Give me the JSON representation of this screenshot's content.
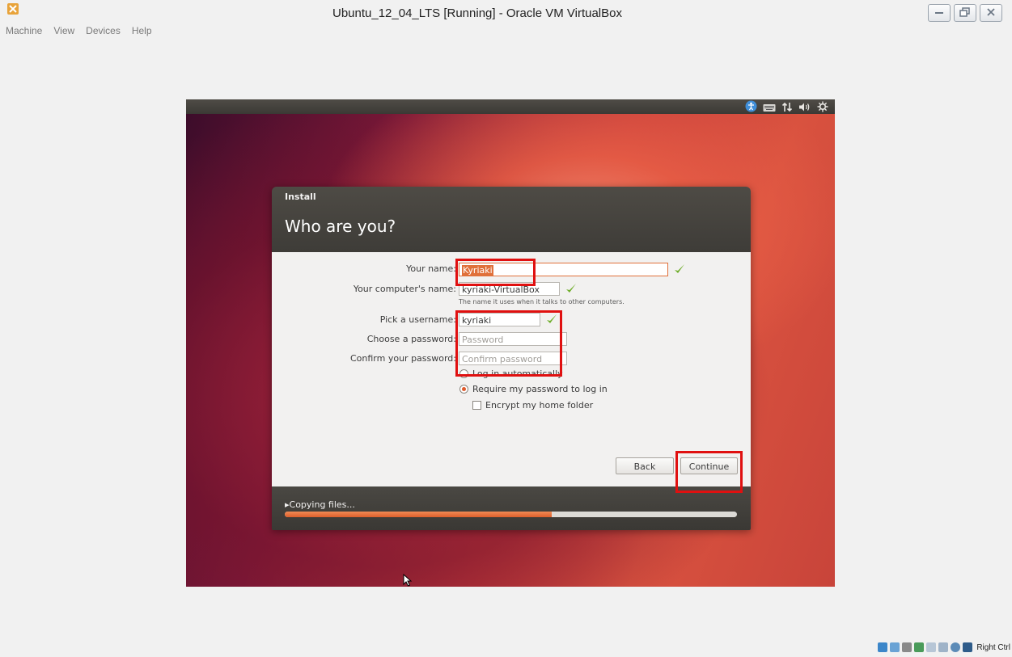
{
  "window": {
    "title": "Ubuntu_12_04_LTS [Running] - Oracle VM VirtualBox",
    "menu": [
      "Machine",
      "View",
      "Devices",
      "Help"
    ]
  },
  "vm": {
    "tray_icons": [
      "accessibility-icon",
      "keyboard-icon",
      "network-icon",
      "volume-icon",
      "settings-gear-icon"
    ]
  },
  "installer": {
    "window_title": "Install",
    "heading": "Who are you?",
    "fields": {
      "your_name": {
        "label": "Your name:",
        "value": "Kyriaki"
      },
      "computer_name": {
        "label": "Your computer's name:",
        "value": "kyriaki-VirtualBox",
        "hint": "The name it uses when it talks to other computers."
      },
      "username": {
        "label": "Pick a username:",
        "value": "kyriaki"
      },
      "password": {
        "label": "Choose a password:",
        "placeholder": "Password"
      },
      "confirm_password": {
        "label": "Confirm your password:",
        "placeholder": "Confirm password"
      }
    },
    "options": {
      "log_in_auto": "Log in automatically",
      "require_password": "Require my password to log in",
      "encrypt_home": "Encrypt my home folder"
    },
    "buttons": {
      "back": "Back",
      "continue": "Continue"
    },
    "progress": {
      "label": "▸Copying files...",
      "fraction": 0.59
    }
  },
  "statusbar": {
    "host_key": "Right Ctrl"
  },
  "colors": {
    "accent": "#df5a2c",
    "annotation": "#e01010",
    "check": "#6fae2a"
  }
}
